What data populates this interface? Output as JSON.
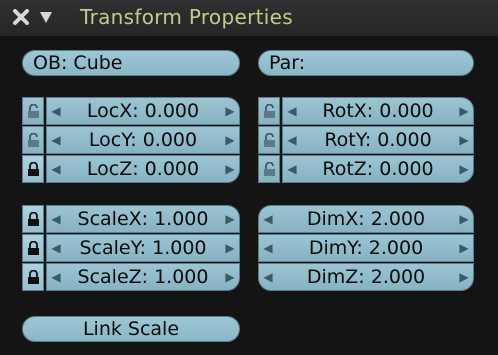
{
  "panel": {
    "title": "Transform Properties",
    "close_icon": "close-icon",
    "collapse_icon": "triangle-down-icon"
  },
  "object_field": {
    "value": "OB: Cube"
  },
  "parent_field": {
    "value": "Par:"
  },
  "location": [
    {
      "label": "LocX: 0.000",
      "locked": false
    },
    {
      "label": "LocY: 0.000",
      "locked": false
    },
    {
      "label": "LocZ: 0.000",
      "locked": true
    }
  ],
  "rotation": [
    {
      "label": "RotX: 0.000",
      "locked": false
    },
    {
      "label": "RotY: 0.000",
      "locked": false
    },
    {
      "label": "RotZ: 0.000",
      "locked": false
    }
  ],
  "scale": [
    {
      "label": "ScaleX: 1.000",
      "locked": true
    },
    {
      "label": "ScaleY: 1.000",
      "locked": true
    },
    {
      "label": "ScaleZ: 1.000",
      "locked": true
    }
  ],
  "dimensions": [
    {
      "label": "DimX: 2.000"
    },
    {
      "label": "DimY: 2.000"
    },
    {
      "label": "DimZ: 2.000"
    }
  ],
  "link_scale_button": {
    "label": "Link Scale"
  },
  "colors": {
    "title": "#c9c98c",
    "field": "#9ec7d5",
    "background": "#141414"
  }
}
